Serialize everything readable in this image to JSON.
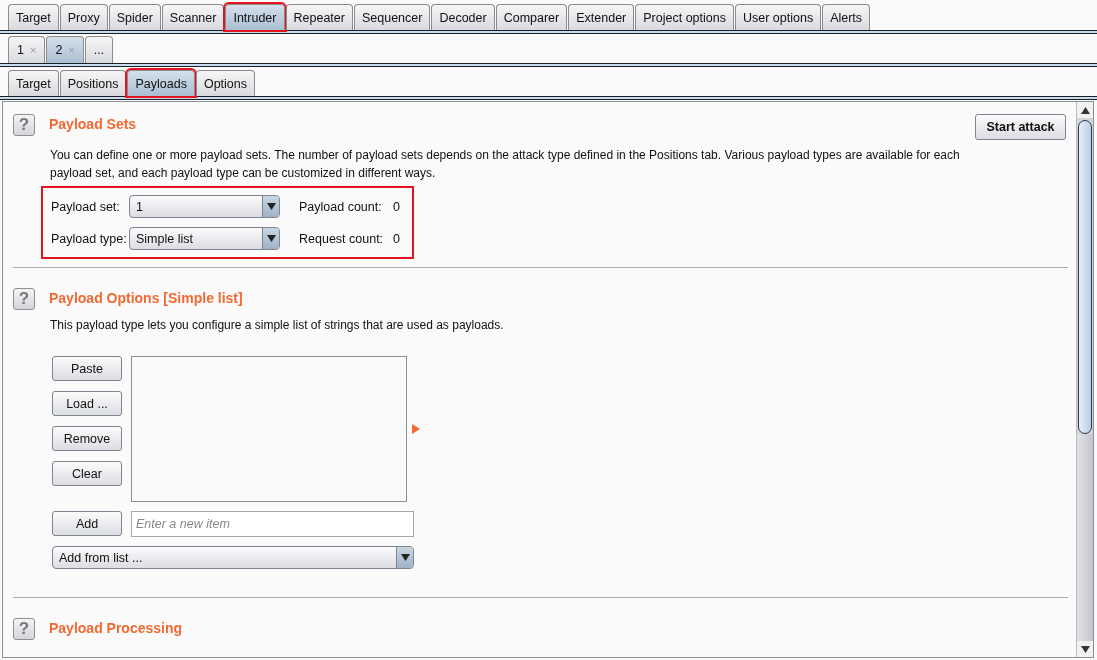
{
  "main_tabs": [
    {
      "label": "Target",
      "selected": false,
      "highlighted": false
    },
    {
      "label": "Proxy",
      "selected": false,
      "highlighted": false
    },
    {
      "label": "Spider",
      "selected": false,
      "highlighted": false
    },
    {
      "label": "Scanner",
      "selected": false,
      "highlighted": false
    },
    {
      "label": "Intruder",
      "selected": true,
      "highlighted": true
    },
    {
      "label": "Repeater",
      "selected": false,
      "highlighted": false
    },
    {
      "label": "Sequencer",
      "selected": false,
      "highlighted": false
    },
    {
      "label": "Decoder",
      "selected": false,
      "highlighted": false
    },
    {
      "label": "Comparer",
      "selected": false,
      "highlighted": false
    },
    {
      "label": "Extender",
      "selected": false,
      "highlighted": false
    },
    {
      "label": "Project options",
      "selected": false,
      "highlighted": false
    },
    {
      "label": "User options",
      "selected": false,
      "highlighted": false
    },
    {
      "label": "Alerts",
      "selected": false,
      "highlighted": false
    }
  ],
  "session_tabs": [
    {
      "label": "1",
      "close": "×",
      "selected": false
    },
    {
      "label": "2",
      "close": "×",
      "selected": true
    },
    {
      "label": "...",
      "selected": false
    }
  ],
  "sub_tabs": [
    {
      "label": "Target",
      "selected": false,
      "highlighted": false
    },
    {
      "label": "Positions",
      "selected": false,
      "highlighted": false
    },
    {
      "label": "Payloads",
      "selected": true,
      "highlighted": true
    },
    {
      "label": "Options",
      "selected": false,
      "highlighted": false
    }
  ],
  "payload_sets": {
    "help": "?",
    "title": "Payload Sets",
    "start_button": "Start attack",
    "description": "You can define one or more payload sets. The number of payload sets depends on the attack type defined in the Positions tab. Various payload types are available for each payload set, and each payload type can be customized in different ways.",
    "highlighted": true,
    "payload_set_label": "Payload set:",
    "payload_set_value": "1",
    "payload_count_label": "Payload count:",
    "payload_count": "0",
    "payload_type_label": "Payload type:",
    "payload_type_value": "Simple list",
    "request_count_label": "Request count:",
    "request_count": "0"
  },
  "payload_options": {
    "help": "?",
    "title": "Payload Options [Simple list]",
    "description": "This payload type lets you configure a simple list of strings that are used as payloads.",
    "buttons": [
      "Paste",
      "Load ...",
      "Remove",
      "Clear"
    ],
    "add_button": "Add",
    "new_item": {
      "placeholder": "Enter a new item"
    },
    "add_from_list": "Add from list ..."
  },
  "payload_processing": {
    "help": "?",
    "title": "Payload Processing"
  }
}
